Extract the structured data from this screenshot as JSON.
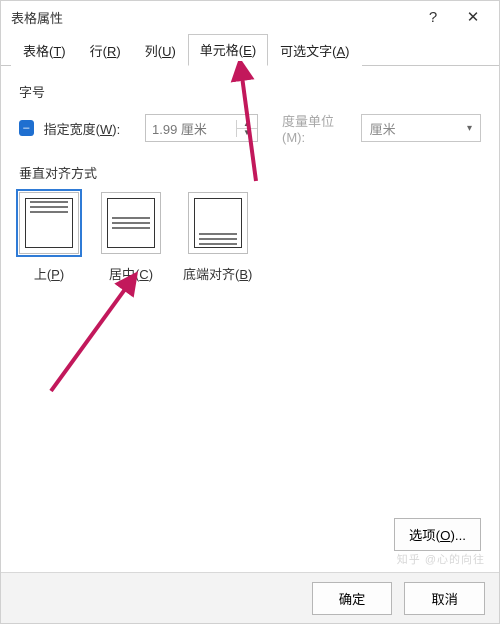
{
  "titlebar": {
    "title": "表格属性",
    "help": "?",
    "close": "✕"
  },
  "tabs": [
    {
      "label": "表格",
      "key": "T"
    },
    {
      "label": "行",
      "key": "R"
    },
    {
      "label": "列",
      "key": "U"
    },
    {
      "label": "单元格",
      "key": "E"
    },
    {
      "label": "可选文字",
      "key": "A"
    }
  ],
  "activeTab": 3,
  "size": {
    "section": "字号",
    "specifyWidth": {
      "label": "指定宽度",
      "key": "W"
    },
    "widthValue": "1.99 厘米",
    "measureLabel": "度量单位(M):",
    "measureUnit": "厘米"
  },
  "valign": {
    "section": "垂直对齐方式",
    "items": [
      {
        "label": "上",
        "key": "P",
        "pos": "top",
        "selected": true
      },
      {
        "label": "居中",
        "key": "C",
        "pos": "middle",
        "selected": false
      },
      {
        "label": "底端对齐",
        "key": "B",
        "pos": "bottom",
        "selected": false
      }
    ]
  },
  "optionsBtn": {
    "label": "选项",
    "key": "O",
    "suffix": "..."
  },
  "footer": {
    "ok": "确定",
    "cancel": "取消"
  },
  "watermark": "知乎 @心的向往"
}
